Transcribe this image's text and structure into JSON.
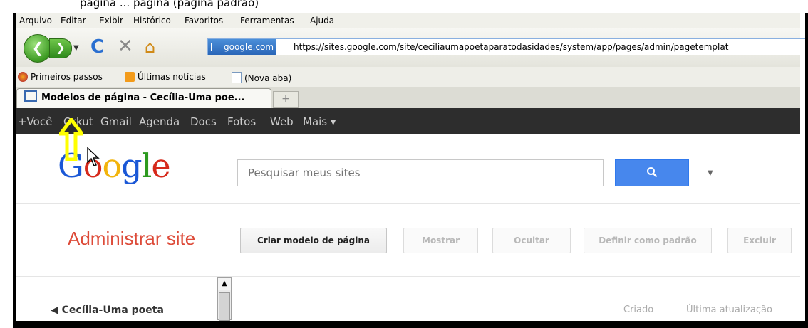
{
  "caption": "página ... página (página padrão)",
  "menubar": {
    "items": [
      "Arquivo",
      "Editar",
      "Exibir",
      "Histórico",
      "Favoritos",
      "Ferramentas",
      "Ajuda"
    ]
  },
  "navbar": {
    "site_badge": "google.com",
    "url": "https://sites.google.com/site/ceciliaumapoetaparatodasidades/system/app/pages/admin/pagetemplat"
  },
  "bookmarks": [
    "Primeiros passos",
    "Últimas notícias",
    "(Nova aba)"
  ],
  "tab": {
    "active_title": "Modelos de página - Cecília-Uma poe...",
    "new_tab_symbol": "+"
  },
  "gbar": {
    "items": [
      "+Você",
      "Orkut",
      "Gmail",
      "Agenda",
      "Docs",
      "Fotos",
      "Web",
      "Mais ▾"
    ]
  },
  "header": {
    "logo_letters": [
      "G",
      "o",
      "o",
      "g",
      "l",
      "e"
    ],
    "logo_colors": [
      "#1a57d6",
      "#d6291b",
      "#f2b40c",
      "#1a57d6",
      "#2d9a1f",
      "#d6291b"
    ],
    "search_placeholder": "Pesquisar meus sites",
    "search_icon": "magnifier-icon",
    "search_button_color": "#4787ed"
  },
  "admin": {
    "title": "Administrar site",
    "title_color": "#dd4b39",
    "buttons": [
      "Criar modelo de página",
      "Mostrar",
      "Ocultar",
      "Definir como padrão",
      "Excluir"
    ]
  },
  "table": {
    "site_name": "◀ Cecília-Uma poeta",
    "columns": [
      "Criado",
      "Última atualização"
    ]
  },
  "annotation": {
    "arrow_color": "#ffff00"
  }
}
